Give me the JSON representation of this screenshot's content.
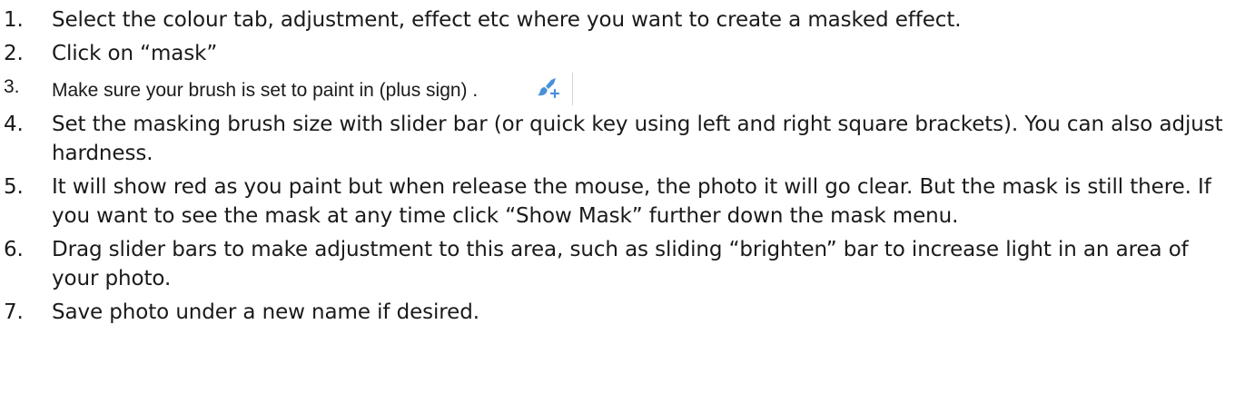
{
  "steps": [
    {
      "num": "1.",
      "text": "Select the colour tab, adjustment, effect etc where you want to create a masked effect."
    },
    {
      "num": "2.",
      "text": "Click on “mask”"
    },
    {
      "num": "3.",
      "text": "Make sure your brush is set to paint in (plus sign) .",
      "icon": "brush-plus-icon"
    },
    {
      "num": "4.",
      "text": "Set the masking brush size with slider bar (or quick key using left and right square brackets). You can also adjust hardness."
    },
    {
      "num": "5.",
      "text": "It will show red as you paint but when release the mouse, the photo it will go clear. But the mask is still there. If you want to see the mask at any time click “Show Mask” further down the mask menu."
    },
    {
      "num": "6.",
      "text": "Drag slider bars to make adjustment to this area, such as sliding “brighten” bar to increase light in an area of your photo."
    },
    {
      "num": "7.",
      "text": "Save photo under a new name if desired."
    }
  ],
  "colors": {
    "text": "#1a1a1a",
    "icon_blue": "#4a90d9"
  }
}
